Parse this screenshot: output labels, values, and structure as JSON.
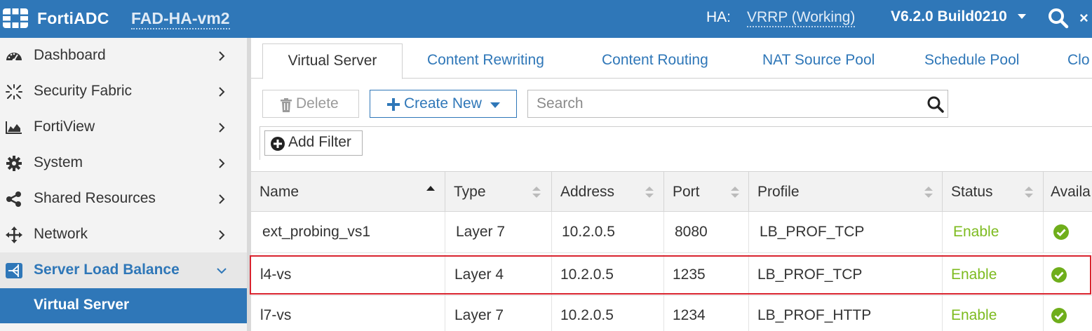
{
  "topbar": {
    "brand": "FortiADC",
    "hostname": "FAD-HA-vm2",
    "ha_label": "HA:",
    "ha_value": "VRRP (Working)",
    "version": "V6.2.0 Build0210",
    "close_glyph": "×",
    "color": "#2f77b8"
  },
  "sidebar": {
    "items": [
      {
        "label": "Dashboard",
        "icon": "dashboard-icon"
      },
      {
        "label": "Security Fabric",
        "icon": "security-fabric-icon"
      },
      {
        "label": "FortiView",
        "icon": "area-chart-icon"
      },
      {
        "label": "System",
        "icon": "gear-icon"
      },
      {
        "label": "Shared Resources",
        "icon": "share-icon"
      },
      {
        "label": "Network",
        "icon": "arrows-move-icon"
      },
      {
        "label": "Server Load Balance",
        "icon": "load-balance-icon"
      }
    ],
    "subitem": "Virtual Server"
  },
  "tabs": [
    "Virtual Server",
    "Content Rewriting",
    "Content Routing",
    "NAT Source Pool",
    "Schedule Pool",
    "Clo"
  ],
  "toolbar": {
    "delete_label": "Delete",
    "create_label": "Create New",
    "search_placeholder": "Search",
    "add_filter_label": "Add Filter"
  },
  "table": {
    "columns": [
      "Name",
      "Type",
      "Address",
      "Port",
      "Profile",
      "Status",
      "Availa"
    ],
    "rows": [
      {
        "name": "ext_probing_vs1",
        "type": "Layer 7",
        "address": "10.2.0.5",
        "port": "8080",
        "profile": "LB_PROF_TCP",
        "status": "Enable"
      },
      {
        "name": "l4-vs",
        "type": "Layer 4",
        "address": "10.2.0.5",
        "port": "1235",
        "profile": "LB_PROF_TCP",
        "status": "Enable"
      },
      {
        "name": "l7-vs",
        "type": "Layer 7",
        "address": "10.2.0.5",
        "port": "1234",
        "profile": "LB_PROF_HTTP",
        "status": "Enable"
      }
    ]
  },
  "colors": {
    "accent": "#2f77b8",
    "enable": "#7dbb1f",
    "highlight": "#d9232e"
  }
}
